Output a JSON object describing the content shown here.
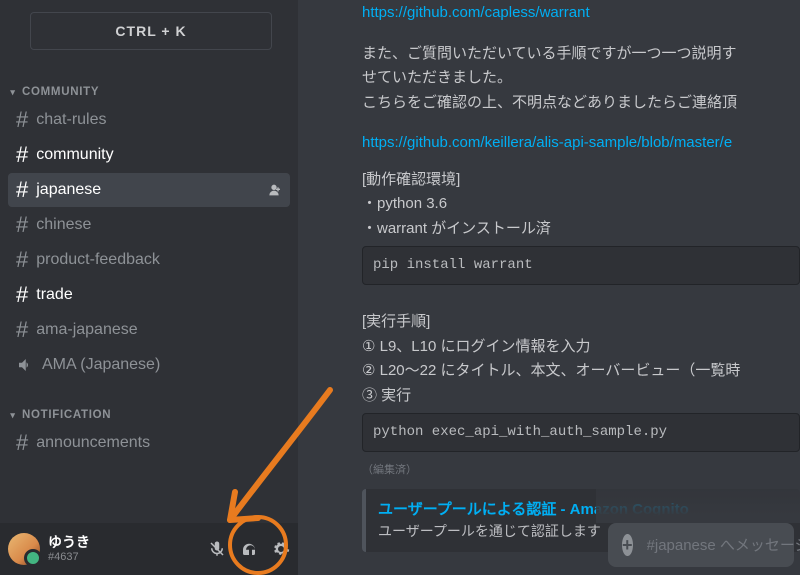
{
  "sidebar": {
    "search_button": "CTRL + K",
    "categories": [
      {
        "name": "COMMUNITY",
        "channels": [
          {
            "label": "chat-rules",
            "bright": false
          },
          {
            "label": "community",
            "bright": true
          },
          {
            "label": "japanese",
            "bright": true,
            "selected": true
          },
          {
            "label": "chinese",
            "bright": false
          },
          {
            "label": "product-feedback",
            "bright": false
          },
          {
            "label": "trade",
            "bright": true
          },
          {
            "label": "ama-japanese",
            "bright": false
          },
          {
            "label": "AMA (Japanese)",
            "bright": false,
            "voice": true
          }
        ]
      },
      {
        "name": "NOTIFICATION",
        "channels": [
          {
            "label": "announcements",
            "bright": false
          }
        ]
      }
    ]
  },
  "user": {
    "name": "ゆうき",
    "tag": "#4637"
  },
  "chat": {
    "link1": "https://github.com/capless/warrant",
    "p1": "また、ご質問いただいている手順ですが一つ一つ説明す",
    "p2": "せていただきました。",
    "p3": "こちらをご確認の上、不明点などありましたらご連絡頂",
    "link2": "https://github.com/keillera/alis-api-sample/blob/master/e",
    "env_header": "[動作確認環境]",
    "env_line1": "・python 3.6",
    "env_line2": "・warrant がインストール済",
    "code1": "pip install warrant",
    "steps_header": "[実行手順]",
    "step1": "① L9、L10 にログイン情報を入力",
    "step2": "② L20〜22 にタイトル、本文、オーバービュー（一覧時",
    "step3": "③ 実行",
    "code2": "python exec_api_with_auth_sample.py",
    "edited": "（編集済）",
    "embed_title": "ユーザープールによる認証 - Amazon Cognito",
    "embed_desc": "ユーザープールを通じて認証します"
  },
  "input": {
    "placeholder": "#japanese へメッセージを送信"
  }
}
